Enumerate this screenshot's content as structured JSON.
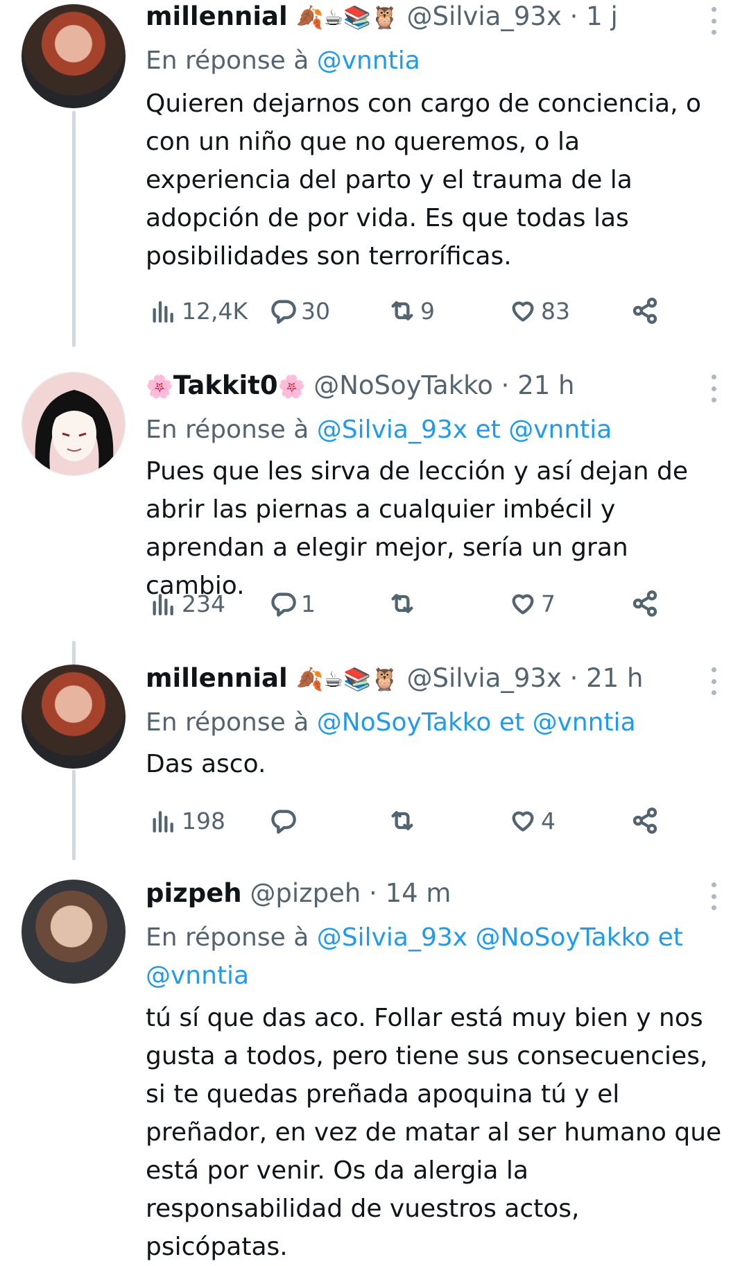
{
  "reply_prefix": "En réponse à",
  "tweets": [
    {
      "display_name": "millennial",
      "emojis": "🍂☕📚🦉",
      "handle": "@Silvia_93x",
      "time": "1 j",
      "reply_mentions": [
        "@vnntia"
      ],
      "reply_joiners": [],
      "text": "Quieren dejarnos con cargo de conciencia, o\ncon un niño que no queremos, o la\nexperiencia del parto y el trauma de la\nadopción de por vida. Es que todas las\nposibilidades son terroríficas.",
      "views": "12,4K",
      "replies": "30",
      "retweets": "9",
      "likes": "83"
    },
    {
      "display_name": "Takkit0",
      "emoji_left": "🌸",
      "emoji_right": "🌸",
      "handle": "@NoSoyTakko",
      "time": "21 h",
      "reply_mentions": [
        "@Silvia_93x",
        "@vnntia"
      ],
      "joiner": "et",
      "text": "Pues que les sirva de lección y así dejan de\nabrir las piernas a cualquier imbécil y\naprendan a elegir mejor, sería un gran cambio.",
      "views": "234",
      "replies": "1",
      "retweets": "",
      "likes": "7"
    },
    {
      "display_name": "millennial",
      "emojis": "🍂☕📚🦉",
      "handle": "@Silvia_93x",
      "time": "21 h",
      "reply_mentions": [
        "@NoSoyTakko",
        "@vnntia"
      ],
      "joiner": "et",
      "text": "Das asco.",
      "views": "198",
      "replies": "",
      "retweets": "",
      "likes": "4"
    },
    {
      "display_name": "pizpeh",
      "handle": "@pizpeh",
      "time": "14 m",
      "reply_mentions": [
        "@Silvia_93x",
        "@NoSoyTakko",
        "@vnntia"
      ],
      "joiner": "et",
      "text": "tú sí que das aco. Follar está muy bien y nos\ngusta a todos, pero tiene sus consecuencies,\nsi te quedas preñada apoquina tú y el\npreñador, en vez de matar al ser humano que\nestá por venir. Os da alergia la\nresponsabilidad de vuestros actos,\npsicópatas."
    }
  ],
  "separator": "·",
  "colors": {
    "mention": "#1d9bf0",
    "secondary": "#536471",
    "thread_line": "#cfd9de"
  },
  "icons": [
    "views-icon",
    "reply-icon",
    "retweet-icon",
    "like-icon",
    "share-icon",
    "more-icon"
  ]
}
